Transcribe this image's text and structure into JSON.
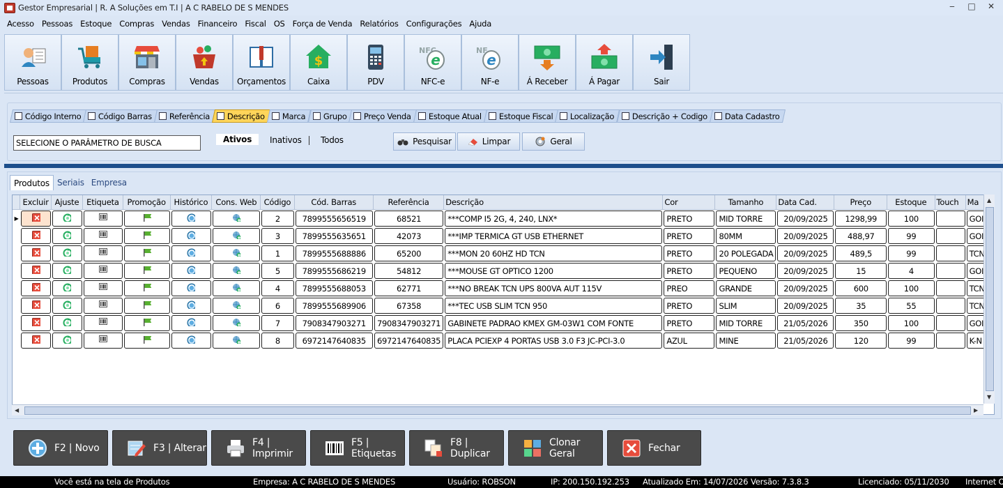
{
  "window": {
    "title": "Gestor Empresarial | R. A Soluções em T.I | A C RABELO DE S MENDES",
    "controls": [
      "‒",
      "□",
      "✕"
    ]
  },
  "menu": [
    "Acesso",
    "Pessoas",
    "Estoque",
    "Compras",
    "Vendas",
    "Financeiro",
    "Fiscal",
    "OS",
    "Força de Venda",
    "Relatórios",
    "Configurações",
    "Ajuda"
  ],
  "toolbar": [
    {
      "label": "Pessoas",
      "icon": "person-icon"
    },
    {
      "label": "Produtos",
      "icon": "cart-icon"
    },
    {
      "label": "Compras",
      "icon": "store-icon"
    },
    {
      "label": "Vendas",
      "icon": "basket-icon"
    },
    {
      "label": "Orçamentos",
      "icon": "book-icon"
    },
    {
      "label": "Caixa",
      "icon": "cash-house-icon"
    },
    {
      "label": "PDV",
      "icon": "pos-terminal-icon"
    },
    {
      "label": "NFC-e",
      "icon": "nfce-icon",
      "badge": "NFC",
      "letter": "e"
    },
    {
      "label": "NF-e",
      "icon": "nfe-icon",
      "badge": "NF",
      "letter": "e"
    },
    {
      "label": "Á Receber",
      "icon": "money-down-icon"
    },
    {
      "label": "Á Pagar",
      "icon": "money-up-icon"
    },
    {
      "label": "Sair",
      "icon": "exit-icon"
    }
  ],
  "search_tabs": [
    {
      "label": "Código Interno"
    },
    {
      "label": "Código Barras"
    },
    {
      "label": "Referência"
    },
    {
      "label": "Descrição",
      "active": true
    },
    {
      "label": "Marca"
    },
    {
      "label": "Grupo"
    },
    {
      "label": "Preço Venda"
    },
    {
      "label": "Estoque Atual"
    },
    {
      "label": "Estoque Fiscal"
    },
    {
      "label": "Localização"
    },
    {
      "label": "Descrição + Codigo"
    },
    {
      "label": "Data Cadastro"
    }
  ],
  "search": {
    "value": "SELECIONE O PARÂMETRO DE BUSCA",
    "filters": {
      "active": "Ativos",
      "inactive": "Inativos",
      "all": "Todos"
    },
    "buttons": {
      "search": "Pesquisar",
      "clear": "Limpar",
      "general": "Geral"
    }
  },
  "grid_tabs": [
    {
      "label": "Produtos",
      "active": true
    },
    {
      "label": "Seriais"
    },
    {
      "label": "Empresa"
    }
  ],
  "columns": [
    "Excluir",
    "Ajuste",
    "Etiqueta",
    "Promoção",
    "Histórico",
    "Cons. Web",
    "Código",
    "Cód. Barras",
    "Referência",
    "Descrição",
    "Cor",
    "Tamanho",
    "Data Cad.",
    "Preço",
    "Estoque",
    "Touch",
    "Ma"
  ],
  "rows": [
    {
      "codigo": "2",
      "barras": "7899555656519",
      "ref": "68521",
      "desc": "***COMP I5 2G, 4, 240, LNX*",
      "cor": "PRETO",
      "tam": "MID TORRE",
      "data": "20/09/2025",
      "preco": "1298,99",
      "estoque": "100",
      "touch": "",
      "marca": "GOI"
    },
    {
      "codigo": "3",
      "barras": "7899555635651",
      "ref": "42073",
      "desc": "***IMP TERMICA GT USB ETHERNET",
      "cor": "PRETO",
      "tam": "80MM",
      "data": "20/09/2025",
      "preco": "488,97",
      "estoque": "99",
      "touch": "",
      "marca": "GOI"
    },
    {
      "codigo": "1",
      "barras": "7899555688886",
      "ref": "65200",
      "desc": "***MON 20 60HZ HD TCN",
      "cor": "PRETO",
      "tam": "20 POLEGADA",
      "data": "20/09/2025",
      "preco": "489,5",
      "estoque": "99",
      "touch": "",
      "marca": "TCN"
    },
    {
      "codigo": "5",
      "barras": "7899555686219",
      "ref": "54812",
      "desc": "***MOUSE GT OPTICO 1200",
      "cor": "PRETO",
      "tam": "PEQUENO",
      "data": "20/09/2025",
      "preco": "15",
      "estoque": "4",
      "touch": "",
      "marca": "GOI"
    },
    {
      "codigo": "4",
      "barras": "7899555688053",
      "ref": "62771",
      "desc": "***NO BREAK TCN UPS 800VA AUT 115V",
      "cor": "PREO",
      "tam": "GRANDE",
      "data": "20/09/2025",
      "preco": "600",
      "estoque": "100",
      "touch": "",
      "marca": "TCN"
    },
    {
      "codigo": "6",
      "barras": "7899555689906",
      "ref": "67358",
      "desc": "***TEC USB SLIM TCN 950",
      "cor": "PRETO",
      "tam": "SLIM",
      "data": "20/09/2025",
      "preco": "35",
      "estoque": "55",
      "touch": "",
      "marca": "TCN"
    },
    {
      "codigo": "7",
      "barras": "7908347903271",
      "ref": "7908347903271",
      "desc": "GABINETE PADRAO KMEX GM-03W1 COM FONTE",
      "cor": "PRETO",
      "tam": "MID TORRE",
      "data": "21/05/2026",
      "preco": "350",
      "estoque": "100",
      "touch": "",
      "marca": "GOI"
    },
    {
      "codigo": "8",
      "barras": "6972147640835",
      "ref": "6972147640835",
      "desc": "PLACA PCIEXP 4 PORTAS USB 3.0 F3 JC-PCI-3.0",
      "cor": "AZUL",
      "tam": "MINE",
      "data": "21/05/2026",
      "preco": "120",
      "estoque": "99",
      "touch": "",
      "marca": "K-N"
    }
  ],
  "actions": [
    {
      "label": "F2 | Novo",
      "icon": "plus-circle-icon"
    },
    {
      "label": "F3 | Alterar",
      "icon": "edit-icon"
    },
    {
      "label": "F4 | Imprimir",
      "icon": "printer-icon"
    },
    {
      "label": "F5 | Etiquetas",
      "icon": "barcode-icon"
    },
    {
      "label": "F8 | Duplicar",
      "icon": "duplicate-icon"
    },
    {
      "label": "Clonar Geral",
      "icon": "clone-icon"
    },
    {
      "label": "Fechar",
      "icon": "close-icon"
    }
  ],
  "status": {
    "screen": "Você está na tela de Produtos",
    "company": "Empresa: A C RABELO DE S MENDES",
    "user": "Usuário: ROBSON",
    "ip": "IP: 200.150.192.253",
    "updated": "Atualizado Em: 14/07/2026",
    "version": "Versão: 7.3.8.3",
    "license": "Licenciado: 05/11/2030",
    "internet": "Internet O"
  }
}
